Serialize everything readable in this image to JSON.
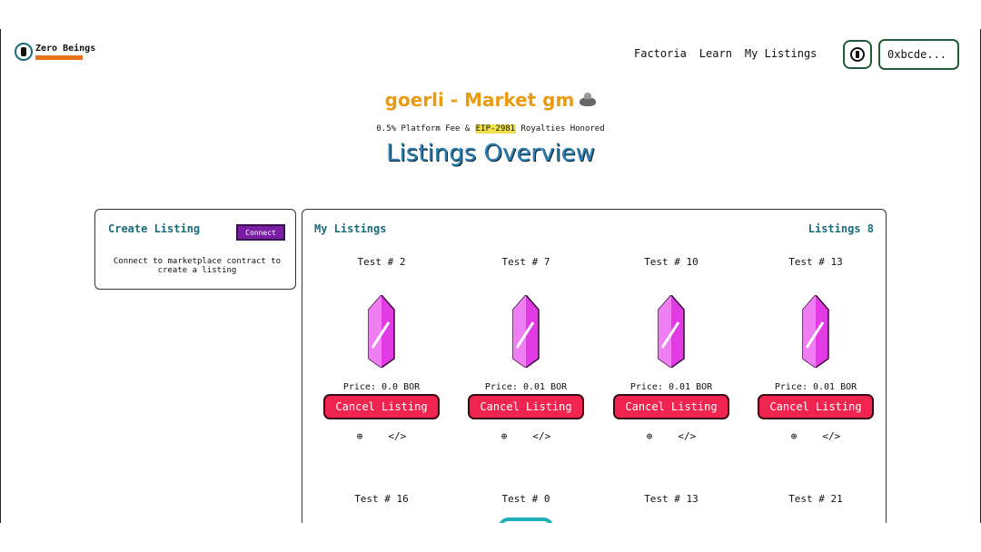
{
  "header": {
    "logo_text": "Zero Beings",
    "logo_tag": "",
    "nav": [
      "Factoria",
      "Learn",
      "My Listings"
    ],
    "address": "0xbcde..."
  },
  "page": {
    "title": "goerli - Market gm",
    "subtitle_pre": "0.5% Platform Fee & ",
    "subtitle_eip": "EIP-2981",
    "subtitle_post": " Royalties Honored",
    "heading": "Listings Overview"
  },
  "create": {
    "title": "Create Listing",
    "connect": "Connect",
    "text": "Connect to marketplace contract to create a listing"
  },
  "listings": {
    "title": "My Listings",
    "count": "Listings 8",
    "cancel_label": "Cancel Listing",
    "cards": [
      {
        "name": "Test # 2",
        "price": "Price: 0.0 BOR"
      },
      {
        "name": "Test # 7",
        "price": "Price: 0.01 BOR"
      },
      {
        "name": "Test # 10",
        "price": "Price: 0.01 BOR"
      },
      {
        "name": "Test # 13",
        "price": "Price: 0.01 BOR"
      }
    ],
    "row2": [
      "Test # 16",
      "Test # 0",
      "Test # 13",
      "Test # 21"
    ]
  },
  "colors": {
    "accent": "#1a6b7a",
    "title": "#e99b12",
    "cancel": "#f0244e",
    "crystal": "#e23be6"
  }
}
